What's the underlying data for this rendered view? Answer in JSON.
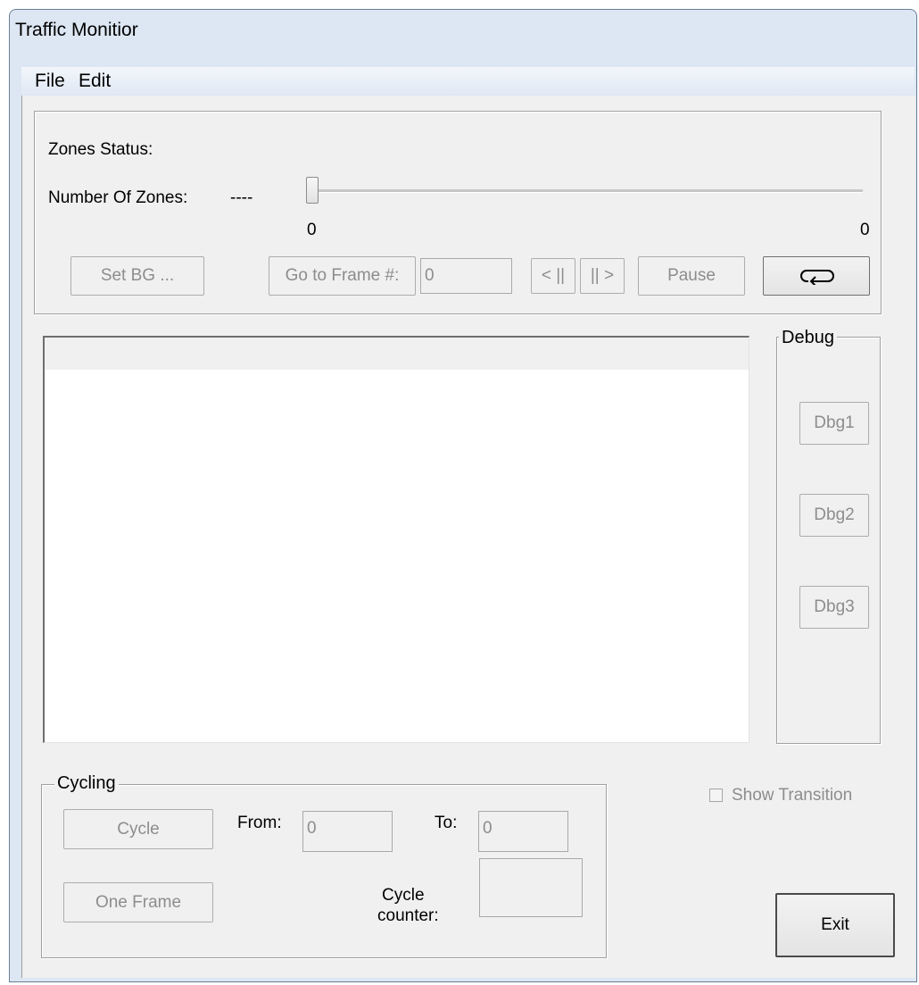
{
  "window": {
    "title": "Traffic Monitior"
  },
  "menu": {
    "file": "File",
    "edit": "Edit"
  },
  "zones": {
    "status_label": "Zones Status:",
    "count_label": "Number Of Zones:",
    "count_value": "----"
  },
  "slider": {
    "min_label": "0",
    "max_label": "0",
    "value": 0
  },
  "controls": {
    "set_bg": "Set BG ...",
    "go_to_frame": "Go to Frame #:",
    "frame_value": "0",
    "prev_frame": "< ||",
    "next_frame": "|| >",
    "pause": "Pause",
    "loop_icon": "loop-arrow-icon"
  },
  "debug": {
    "title": "Debug",
    "buttons": [
      "Dbg1",
      "Dbg2",
      "Dbg3"
    ]
  },
  "cycling": {
    "title": "Cycling",
    "cycle": "Cycle",
    "one_frame": "One Frame",
    "from_label": "From:",
    "from_value": "0",
    "to_label": "To:",
    "to_value": "0",
    "counter_label_1": "Cycle",
    "counter_label_2": "counter:",
    "counter_value": ""
  },
  "show_transition": {
    "label": "Show Transition",
    "checked": false
  },
  "exit": "Exit"
}
